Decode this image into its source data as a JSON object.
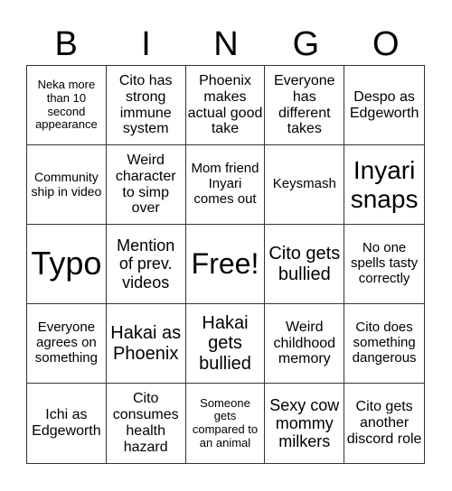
{
  "header": {
    "letters": [
      "B",
      "I",
      "N",
      "G",
      "O"
    ]
  },
  "board": {
    "cells": [
      "Neka more than 10 second appearance",
      "Cito has strong immune system",
      "Phoenix makes actual good take",
      "Everyone has different takes",
      "Despo as Edgeworth",
      "Community ship in video",
      "Weird character to simp over",
      "Mom friend Inyari comes out",
      "Keysmash",
      "Inyari snaps",
      "Typo",
      "Mention of prev. videos",
      "Free!",
      "Cito gets bullied",
      "No one spells tasty correctly",
      "Everyone agrees on something",
      "Hakai as Phoenix",
      "Hakai gets bullied",
      "Weird childhood memory",
      "Cito does something dangerous",
      "Ichi as Edgeworth",
      "Cito consumes health hazard",
      "Someone gets compared to an animal",
      "Sexy cow mommy milkers",
      "Cito gets another discord role"
    ],
    "free_space_index": 12
  }
}
